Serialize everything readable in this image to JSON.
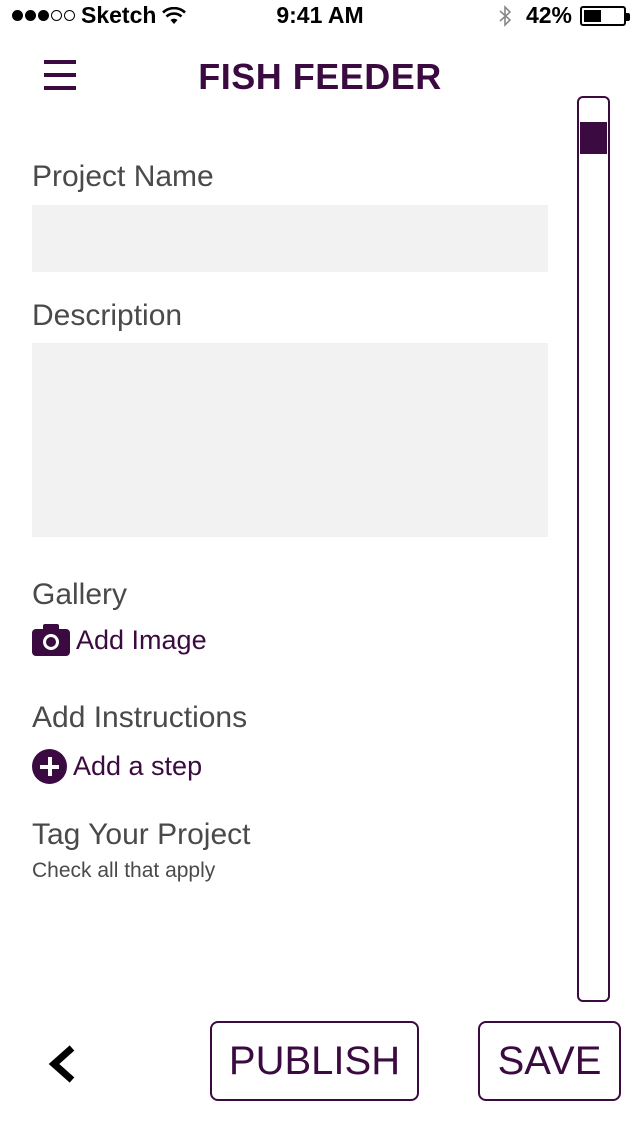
{
  "status_bar": {
    "carrier": "Sketch",
    "time": "9:41 AM",
    "battery_percent": "42%",
    "signal_bars_filled": 3,
    "signal_bars_total": 5,
    "battery_level": 0.42
  },
  "header": {
    "title": "FISH FEEDER",
    "menu_icon": "hamburger-menu-icon"
  },
  "form": {
    "project_name": {
      "label": "Project Name",
      "value": "",
      "placeholder": ""
    },
    "description": {
      "label": "Description",
      "value": "",
      "placeholder": ""
    },
    "gallery": {
      "label": "Gallery",
      "add_label": "Add Image",
      "icon": "camera-icon"
    },
    "instructions": {
      "label": "Add Instructions",
      "add_label": "Add a step",
      "icon": "plus-circle-icon"
    },
    "tags": {
      "label": "Tag Your Project",
      "hint": "Check all that apply"
    }
  },
  "scrollbar": {
    "position": 0.0
  },
  "footer": {
    "back_icon": "chevron-left-icon",
    "publish_label": "PUBLISH",
    "save_label": "SAVE"
  },
  "colors": {
    "accent": "#3a0a40",
    "field_background": "#f2f2f2",
    "label_text": "#4a4a4a"
  }
}
